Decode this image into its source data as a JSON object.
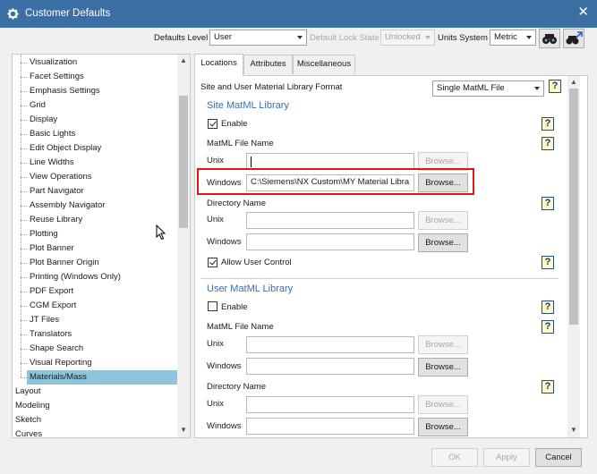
{
  "window": {
    "title": "Customer Defaults",
    "close_glyph": "✕"
  },
  "toolbar": {
    "defaults_level_label": "Defaults Level",
    "defaults_level_value": "User",
    "lock_state_label": "Default Lock State",
    "lock_state_value": "Unlocked",
    "units_system_label": "Units System",
    "units_system_value": "Metric"
  },
  "tree": {
    "items": [
      {
        "label": "Visualization"
      },
      {
        "label": "Facet Settings"
      },
      {
        "label": "Emphasis Settings"
      },
      {
        "label": "Grid"
      },
      {
        "label": "Display"
      },
      {
        "label": "Basic Lights"
      },
      {
        "label": "Edit Object Display"
      },
      {
        "label": "Line Widths"
      },
      {
        "label": "View Operations"
      },
      {
        "label": "Part Navigator"
      },
      {
        "label": "Assembly Navigator"
      },
      {
        "label": "Reuse Library"
      },
      {
        "label": "Plotting"
      },
      {
        "label": "Plot Banner"
      },
      {
        "label": "Plot Banner Origin"
      },
      {
        "label": "Printing (Windows Only)"
      },
      {
        "label": "PDF Export"
      },
      {
        "label": "CGM Export"
      },
      {
        "label": "JT Files"
      },
      {
        "label": "Translators"
      },
      {
        "label": "Shape Search"
      },
      {
        "label": "Visual Reporting"
      },
      {
        "label": "Materials/Mass",
        "selected": true
      }
    ],
    "root_items": [
      {
        "label": "Layout"
      },
      {
        "label": "Modeling"
      },
      {
        "label": "Sketch"
      },
      {
        "label": "Curves"
      }
    ]
  },
  "tabs": [
    {
      "label": "Locations",
      "active": true
    },
    {
      "label": "Attributes"
    },
    {
      "label": "Miscellaneous"
    }
  ],
  "panel": {
    "format_label": "Site and User Material Library Format",
    "format_value": "Single MatML File",
    "help_glyph": "?",
    "site": {
      "title": "Site MatML Library",
      "enable_label": "Enable",
      "enable_checked": true,
      "file_name_label": "MatML File Name",
      "unix_label": "Unix",
      "unix_value": "",
      "unix_browse": "Browse...",
      "windows_label": "Windows",
      "windows_value": "C:\\Siemens\\NX Custom\\MY Material Libra",
      "windows_browse": "Browse...",
      "directory_label": "Directory Name",
      "dir_unix_label": "Unix",
      "dir_unix_browse": "Browse...",
      "dir_windows_label": "Windows",
      "dir_windows_browse": "Browse...",
      "allow_label": "Allow User Control",
      "allow_checked": true
    },
    "user": {
      "title": "User MatML Library",
      "enable_label": "Enable",
      "enable_checked": false,
      "file_name_label": "MatML File Name",
      "unix_label": "Unix",
      "unix_browse": "Browse...",
      "windows_label": "Windows",
      "windows_browse": "Browse...",
      "directory_label": "Directory Name",
      "dir_unix_label": "Unix",
      "dir_unix_browse": "Browse...",
      "dir_windows_label": "Windows",
      "dir_windows_browse": "Browse..."
    }
  },
  "footer": {
    "ok": "OK",
    "apply": "Apply",
    "cancel": "Cancel"
  },
  "colors": {
    "titlebar": "#3b6fa4",
    "selection": "#8ec5da",
    "section_title": "#3a6fa7",
    "highlight": "#e4141b"
  }
}
